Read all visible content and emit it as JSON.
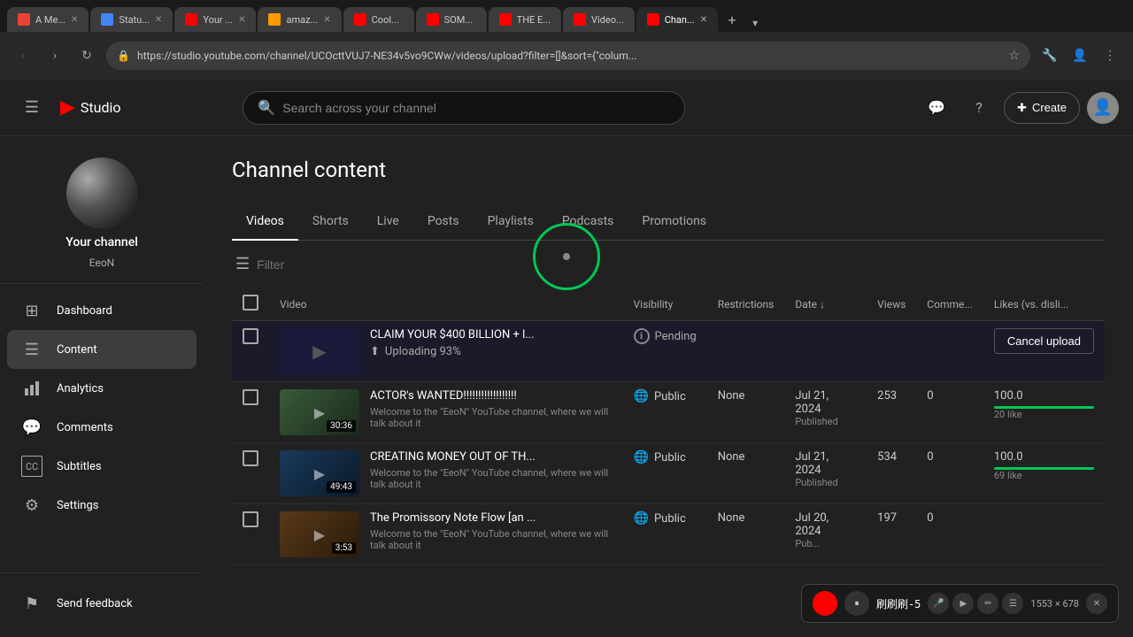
{
  "browser": {
    "tabs": [
      {
        "label": "A Me...",
        "active": false,
        "favicon": "gmail"
      },
      {
        "label": "Statu...",
        "active": false,
        "favicon": "status"
      },
      {
        "label": "Your ...",
        "active": false,
        "favicon": "youtube"
      },
      {
        "label": "amaz...",
        "active": false,
        "favicon": "amazon"
      },
      {
        "label": "Cool...",
        "active": false,
        "favicon": "youtube"
      },
      {
        "label": "SOM...",
        "active": false,
        "favicon": "youtube"
      },
      {
        "label": "THE E...",
        "active": false,
        "favicon": "youtube"
      },
      {
        "label": "Video...",
        "active": false,
        "favicon": "youtube"
      },
      {
        "label": "Chan...",
        "active": true,
        "favicon": "youtube"
      }
    ],
    "url": "https://studio.youtube.com/channel/UCOcttVUJ7-NE34v5vo9CWw/videos/upload?filter=[]&sort={\"colum..."
  },
  "topbar": {
    "logo_text": "Studio",
    "search_placeholder": "Search across your channel",
    "create_label": "Create"
  },
  "sidebar": {
    "channel_name": "Your channel",
    "channel_handle": "EeoN",
    "items": [
      {
        "label": "Dashboard",
        "icon": "⊞",
        "active": false
      },
      {
        "label": "Content",
        "icon": "≡",
        "active": true
      },
      {
        "label": "Analytics",
        "icon": "📊",
        "active": false
      },
      {
        "label": "Comments",
        "icon": "💬",
        "active": false
      },
      {
        "label": "Subtitles",
        "icon": "CC",
        "active": false
      },
      {
        "label": "Settings",
        "icon": "⚙",
        "active": false
      }
    ],
    "send_feedback": "Send feedback"
  },
  "main": {
    "page_title": "Channel content",
    "tabs": [
      {
        "label": "Videos",
        "active": true
      },
      {
        "label": "Shorts",
        "active": false
      },
      {
        "label": "Live",
        "active": false
      },
      {
        "label": "Posts",
        "active": false
      },
      {
        "label": "Playlists",
        "active": false
      },
      {
        "label": "Podcasts",
        "active": false
      },
      {
        "label": "Promotions",
        "active": false
      }
    ],
    "filter_placeholder": "Filter",
    "table": {
      "headers": [
        "Video",
        "Visibility",
        "Restrictions",
        "Date",
        "Views",
        "Comme...",
        "Likes (vs. disli..."
      ],
      "rows": [
        {
          "type": "upload",
          "title": "CLAIM YOUR $400 BILLION + l...",
          "upload_progress": "Uploading 93%",
          "visibility": "Pending",
          "cancel_label": "Cancel upload"
        },
        {
          "type": "video",
          "thumb_color": "#2a3a2a",
          "thumb_duration": "30:36",
          "title": "ACTOR's WANTED!!!!!!!!!!!!!!!!!!",
          "desc": "Welcome to the \"EeoN\" YouTube channel, where we will talk about it",
          "visibility": "Public",
          "restrictions": "None",
          "date": "Jul 21, 2024",
          "date_status": "Published",
          "views": "253",
          "comments": "0",
          "likes": "100.0",
          "likes_label": "20 like",
          "likes_bar_width": "100"
        },
        {
          "type": "video",
          "thumb_color": "#1a2a3a",
          "thumb_duration": "49:43",
          "title": "CREATING MONEY OUT OF TH...",
          "desc": "Welcome to the \"EeoN\" YouTube channel, where we will talk about it",
          "visibility": "Public",
          "restrictions": "None",
          "date": "Jul 21, 2024",
          "date_status": "Published",
          "views": "534",
          "comments": "0",
          "likes": "100.0",
          "likes_label": "69 like",
          "likes_bar_width": "100"
        },
        {
          "type": "video",
          "thumb_color": "#3a2a1a",
          "thumb_duration": "3:53",
          "title": "The Promissory Note Flow [an ...",
          "desc": "Welcome to the \"EeoN\" YouTube channel, where we will talk about it",
          "visibility": "Public",
          "restrictions": "None",
          "date": "Jul 20, 2024",
          "date_status": "Pub...",
          "views": "197",
          "comments": "0",
          "likes": "",
          "likes_label": "",
          "likes_bar_width": "0"
        }
      ]
    }
  },
  "recording_bar": {
    "timer": "刷刷刷-5",
    "resolution": "1553 × 678"
  }
}
